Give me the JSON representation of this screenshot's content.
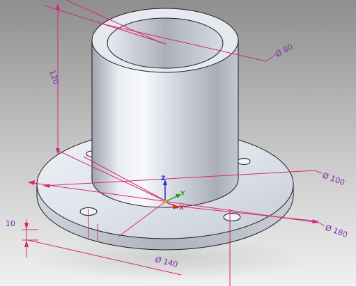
{
  "viewport": {
    "background_top": "#8e8e8e",
    "background_bottom": "#f1f1f1"
  },
  "model": {
    "description_colors": {
      "steel_light": "#f4f6fa",
      "steel_mid": "#c9cdd6",
      "steel_dark": "#8d929c",
      "edge": "#1c1c1c"
    }
  },
  "dimensions": {
    "height": "120",
    "inner_diameter": "Ø 80",
    "tube_diameter": "Ø 100",
    "bolt_circle": "Ø 140",
    "flange_diameter": "Ø 180",
    "flange_thickness": "10",
    "color": "#d6267a",
    "text_color": "#7a2aa8"
  },
  "triad": {
    "x_label": "X",
    "y_label": "Y",
    "z_label": "Z",
    "x_color": "#e02020",
    "y_color": "#20a020",
    "z_color": "#2030d0"
  }
}
